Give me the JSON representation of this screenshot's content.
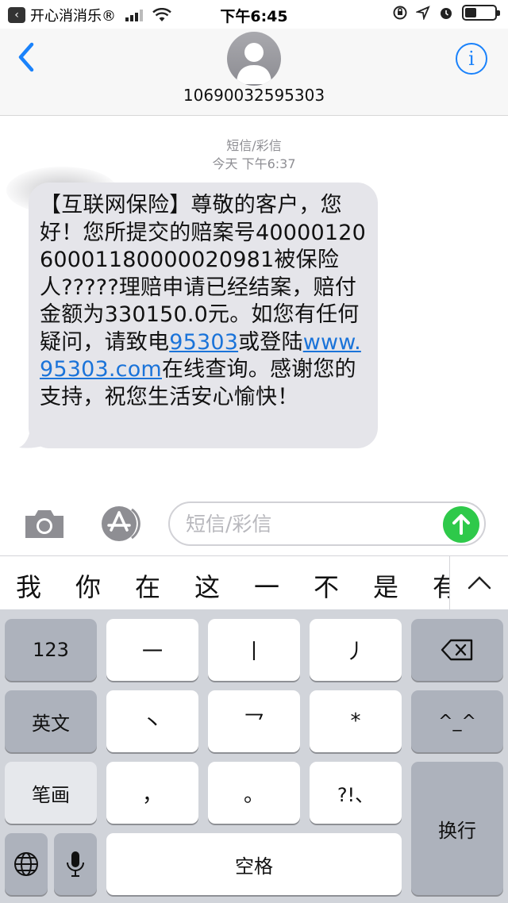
{
  "status_bar": {
    "carrier": "开心消消乐®",
    "back_app_icon": "back-chevron-icon",
    "time": "下午6:45"
  },
  "header": {
    "contact_number": "10690032595303",
    "back_icon": "chevron-left-icon",
    "info_label": "i"
  },
  "conversation": {
    "message_type": "短信/彩信",
    "timestamp": "今天 下午6:37",
    "message": {
      "text_before_phone": "【互联网保险】尊敬的客户，您好！您所提交的赔案号40000120600011800000209​81被保险人?????理赔申请已经结案，赔付金额为330150.0元。如您有任何疑问，请致电",
      "phone_link": "95303",
      "text_between": "或登陆",
      "web_link": "www.95303.com",
      "text_after": "在线查询。感谢您的支持，祝您生活安心愉快！"
    }
  },
  "compose": {
    "placeholder": "短信/彩信"
  },
  "candidates": [
    "我",
    "你",
    "在",
    "这",
    "一",
    "不",
    "是",
    "有"
  ],
  "keyboard": {
    "key_123": "123",
    "key_stroke_h": "一",
    "key_stroke_s": "丨",
    "key_stroke_p": "丿",
    "key_english": "英文",
    "key_stroke_d": "丶",
    "key_stroke_z": "乛",
    "key_star": "*",
    "key_emoji": "^_^",
    "key_bihua": "笔画",
    "key_comma": "，",
    "key_period": "。",
    "key_punct": "?!、",
    "key_return": "换行",
    "key_space": "空格"
  },
  "colors": {
    "accent_blue": "#1a82fb",
    "send_green": "#2ec94a",
    "bubble_gray": "#e5e5ea",
    "keyboard_bg": "#d1d4da"
  }
}
